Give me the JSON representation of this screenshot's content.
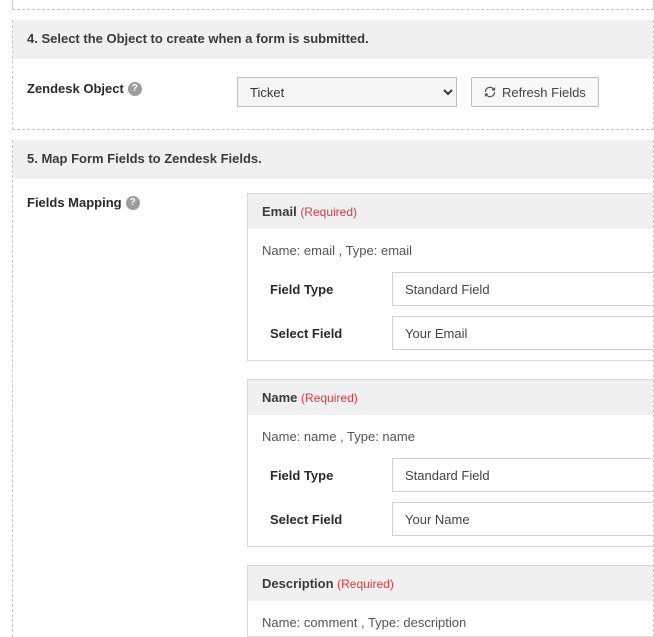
{
  "section4": {
    "title": "4. Select the Object to create when a form is submitted.",
    "label": "Zendesk Object",
    "select_value": "Ticket",
    "refresh_label": "Refresh Fields"
  },
  "section5": {
    "title": "5. Map Form Fields to Zendesk Fields.",
    "label": "Fields Mapping",
    "required_text": "(Required)",
    "field_type_label": "Field Type",
    "select_field_label": "Select Field",
    "cards": [
      {
        "title": "Email",
        "meta": "Name: email , Type: email",
        "field_type_value": "Standard Field",
        "select_field_value": "Your Email"
      },
      {
        "title": "Name",
        "meta": "Name: name , Type: name",
        "field_type_value": "Standard Field",
        "select_field_value": "Your Name"
      },
      {
        "title": "Description",
        "meta": "Name: comment , Type: description"
      }
    ]
  }
}
